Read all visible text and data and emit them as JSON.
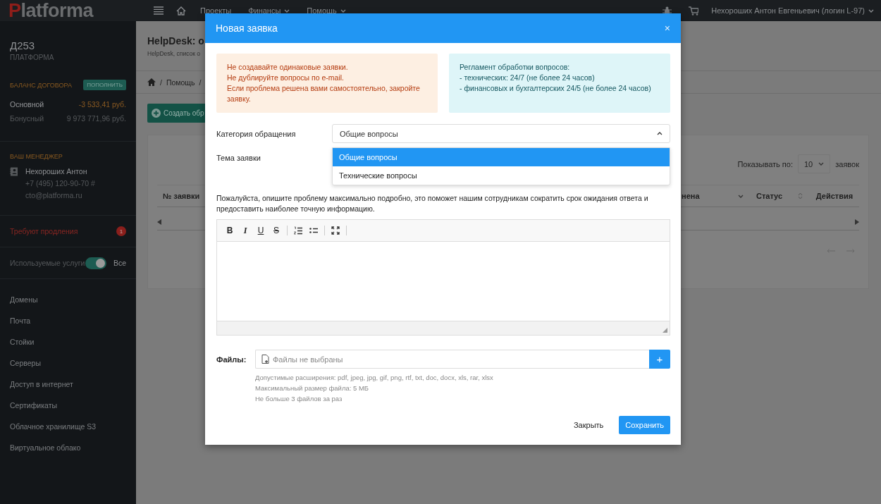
{
  "topbar": {
    "logo": "Platforma",
    "nav": [
      {
        "label": "Проекты",
        "dropdown": false
      },
      {
        "label": "Финансы",
        "dropdown": true
      },
      {
        "label": "Помощь",
        "dropdown": true
      }
    ],
    "user": "Нехороших Антон Евгеньевич (логин L-97)"
  },
  "sidebar": {
    "account": "Д253",
    "account_sub": "ПЛАТФОРМА",
    "balance_title": "БАЛАНС ДОГОВОРА",
    "top_up": "ПОПОЛНИТЬ",
    "balances": [
      {
        "label": "Основной",
        "value": "-3 533,41 руб.",
        "negative": true
      },
      {
        "label": "Бонусный",
        "value": "9 973 771,96 руб.",
        "negative": false
      }
    ],
    "manager_title": "ВАШ МЕНЕДЖЕР",
    "manager": {
      "name": "Нехороших Антон",
      "phone": "+7 (495) 120-90-70 #",
      "email": "cto@platforma.ru"
    },
    "renewal": {
      "label": "Требуют продления",
      "count": "1"
    },
    "services_toggle": {
      "label": "Используемые услуги",
      "on": true,
      "value": "Все"
    },
    "menu": [
      "Домены",
      "Почта",
      "Стойки",
      "Серверы",
      "Доступ в интернет",
      "Сертификаты",
      "Облачное хранилище S3",
      "Виртуальное облако"
    ]
  },
  "page": {
    "title": "HelpDesk: о",
    "subtitle": "HelpDesk, список о",
    "breadcrumb": [
      "/",
      "Помощь",
      "/"
    ],
    "create_button": "Создать обр",
    "page_size_label": "Показывать по:",
    "page_size": "10",
    "page_size_unit": "заявок",
    "columns": [
      {
        "label": "№ заявки"
      },
      {
        "label": "нена",
        "sorted": true
      },
      {
        "label": "Статус",
        "sorted": false
      },
      {
        "label": "Действия"
      }
    ]
  },
  "modal": {
    "title": "Новая заявка",
    "close": "×",
    "warning": [
      "Не создавайте одинаковые заявки.",
      "Не дублируйте вопросы по e-mail.",
      "Если проблема решена вами самостоятельно, закройте заявку."
    ],
    "info": [
      "Регламент обработки вопросов:",
      "- технических: 24/7 (не более 24 часов)",
      "- финансовых и бухгалтерских 24/5 (не более 24 часов)"
    ],
    "category": {
      "label": "Категория обращения",
      "value": "Общие вопросы",
      "expanded": true,
      "options": [
        {
          "label": "Общие вопросы",
          "selected": true
        },
        {
          "label": "Технические вопросы",
          "selected": false
        }
      ]
    },
    "subject": {
      "label": "Тема заявки"
    },
    "description": "Пожалуйста, опишите проблему максимально подробно, это поможет нашим сотрудникам сократить срок ожидания ответа и предоставить наиболее точную информацию.",
    "toolbar": [
      {
        "kind": "bold",
        "label": "B"
      },
      {
        "kind": "italic",
        "label": "I"
      },
      {
        "kind": "underline",
        "label": "U"
      },
      {
        "kind": "strike",
        "label": "S"
      },
      {
        "kind": "separator"
      },
      {
        "kind": "ordered-list"
      },
      {
        "kind": "bullet-list"
      },
      {
        "kind": "separator"
      },
      {
        "kind": "fullscreen"
      },
      {
        "kind": "separator"
      }
    ],
    "files": {
      "label": "Файлы:",
      "placeholder": "Файлы не выбраны",
      "add": "+",
      "hints": [
        "Допустимые расширения: pdf, jpeg, jpg, gif, png, rtf, txt, doc, docx, xls, rar, xlsx",
        "Максимальный размер файла: 5 МБ",
        "Не больше 3 файлов за раз"
      ]
    },
    "buttons": {
      "close": "Закрыть",
      "save": "Сохранить"
    }
  }
}
